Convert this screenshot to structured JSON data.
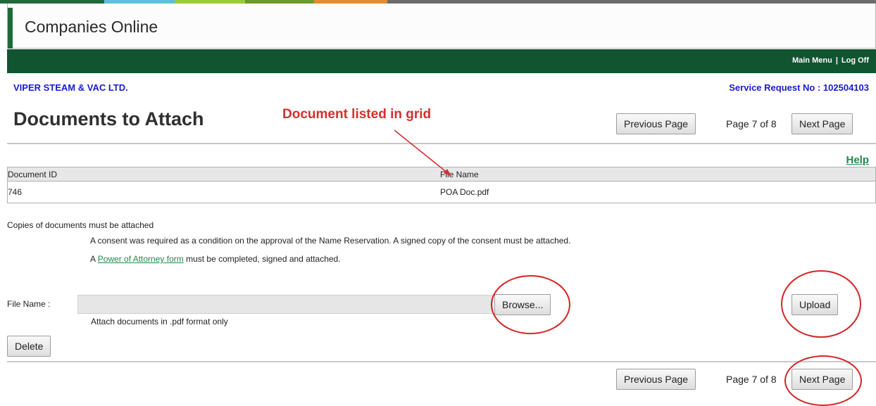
{
  "colors": {
    "stripe": [
      "#1e6a3a",
      "#5bc0de",
      "#9acd32",
      "#6b9b2a",
      "#e68a2e",
      "#6b6b6b"
    ],
    "nav_green": "#115430",
    "link_blue": "#1a1ad2",
    "link_green": "#1f8a4c",
    "annotation_red": "#d32f2f"
  },
  "app": {
    "title": "Companies Online"
  },
  "nav": {
    "main_menu": "Main Menu",
    "separator": "|",
    "log_off": "Log Off"
  },
  "company": {
    "name": "VIPER STEAM & VAC LTD.",
    "service_request": "Service Request No : 102504103"
  },
  "page": {
    "title": "Documents to Attach",
    "previous_label": "Previous Page",
    "indicator": "Page 7 of 8",
    "next_label": "Next Page",
    "help": "Help"
  },
  "annotation": {
    "text": "Document listed in grid"
  },
  "grid": {
    "headers": [
      "Document ID",
      "File Name"
    ],
    "rows": [
      {
        "document_id": "746",
        "file_name": "POA Doc.pdf"
      }
    ]
  },
  "notes": {
    "heading": "Copies of documents must be attached",
    "consent": "A consent was required as a condition on the approval of the Name Reservation. A signed copy of the consent must be attached.",
    "poa_prefix": "A ",
    "poa_link": "Power of Attorney form",
    "poa_suffix": " must be completed, signed and attached."
  },
  "upload": {
    "file_label": "File Name :",
    "file_value": "",
    "browse_label": "Browse...",
    "upload_label": "Upload",
    "hint": "Attach documents in .pdf format only",
    "delete_label": "Delete"
  }
}
